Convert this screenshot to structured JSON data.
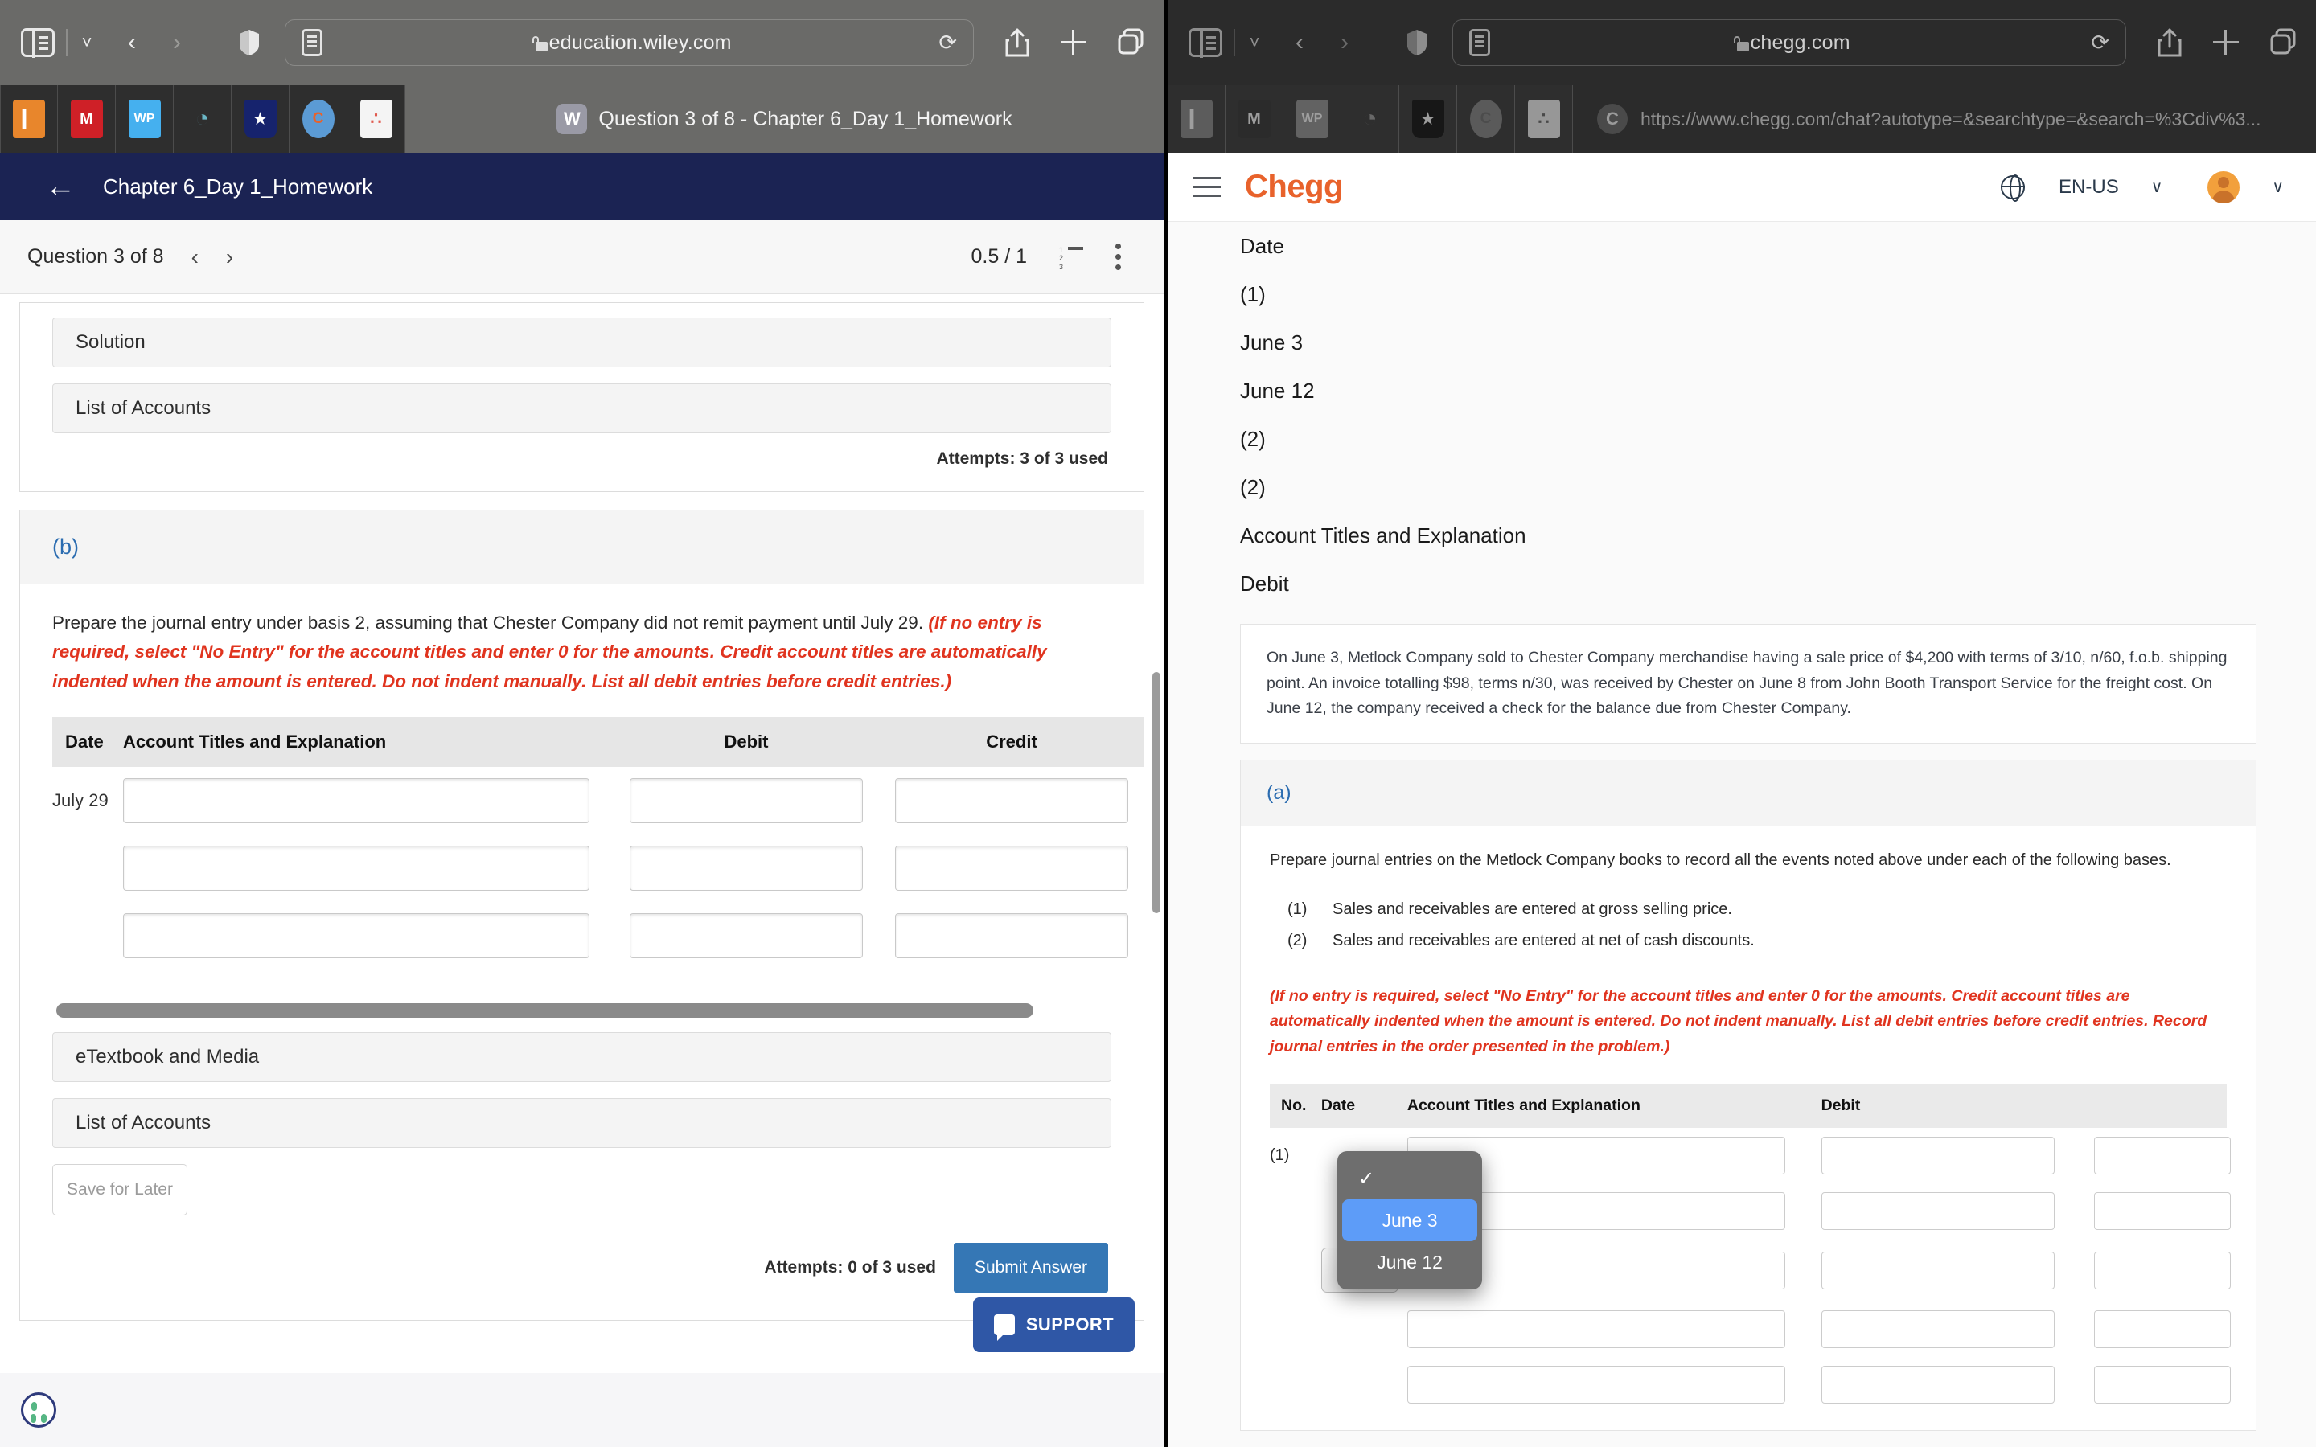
{
  "left_browser": {
    "url": "education.wiley.com",
    "url_lock": "lock-icon",
    "tab_favicon_letter": "W",
    "tab_title": "Question 3 of 8 - Chapter 6_Day 1_Homework",
    "favorites": [
      {
        "name": "bookmark-orange",
        "glyph": "▎"
      },
      {
        "name": "bookmark-m",
        "glyph": "M"
      },
      {
        "name": "bookmark-wp",
        "glyph": "WP"
      },
      {
        "name": "bookmark-vialto",
        "glyph": "◔"
      },
      {
        "name": "bookmark-star-shield",
        "glyph": "★"
      },
      {
        "name": "bookmark-chegg",
        "glyph": "C"
      },
      {
        "name": "bookmark-canvas",
        "glyph": "∴"
      }
    ]
  },
  "right_browser": {
    "url": "chegg.com",
    "tab_favicon_letter": "C",
    "full_url": "https://www.chegg.com/chat?autotype=&searchtype=&search=%3Cdiv%3...",
    "favorites": [
      {
        "name": "bookmark-orange",
        "glyph": "▎"
      },
      {
        "name": "bookmark-m",
        "glyph": "M"
      },
      {
        "name": "bookmark-wp",
        "glyph": "WP"
      },
      {
        "name": "bookmark-vialto",
        "glyph": "◔"
      },
      {
        "name": "bookmark-star-shield",
        "glyph": "★"
      },
      {
        "name": "bookmark-chegg",
        "glyph": "C"
      },
      {
        "name": "bookmark-canvas",
        "glyph": "∴"
      }
    ]
  },
  "wiley": {
    "header_title": "Chapter 6_Day 1_Homework",
    "back_arrow": "back-arrow-icon",
    "question_label": "Question 3 of 8",
    "prev_chevron": "‹",
    "next_chevron": "›",
    "score": "0.5 / 1",
    "part_a": {
      "solution_label": "Solution",
      "list_of_accounts_label": "List of Accounts",
      "attempts": "Attempts: 3 of 3 used"
    },
    "part_b": {
      "letter": "(b)",
      "prompt_plain": "Prepare the journal entry under basis 2, assuming that Chester Company did not remit payment until July 29. ",
      "prompt_red": "(If no entry is required, select \"No Entry\" for the account titles and enter 0 for the amounts. Credit account titles are automatically indented when the amount is entered. Do not indent manually. List all debit entries before credit entries.)",
      "table_headers": [
        "Date",
        "Account Titles and Explanation",
        "Debit",
        "Credit"
      ],
      "rows": [
        {
          "date": "July 29",
          "account": "",
          "debit": "",
          "credit": ""
        },
        {
          "date": "",
          "account": "",
          "debit": "",
          "credit": ""
        },
        {
          "date": "",
          "account": "",
          "debit": "",
          "credit": ""
        }
      ],
      "etextbook_label": "eTextbook and Media",
      "list_of_accounts_label": "List of Accounts",
      "save_for_later": "Save for Later",
      "attempts": "Attempts: 0 of 3 used",
      "submit_label": "Submit Answer"
    },
    "support_label": "SUPPORT"
  },
  "chegg": {
    "logo": "Chegg",
    "language": "EN-US",
    "plain_lines": [
      "Date",
      "(1)",
      "June 3",
      "June 12",
      "(2)",
      "(2)",
      "Account Titles and Explanation",
      "Debit"
    ],
    "problem_text": "On June 3, Metlock Company sold to Chester Company merchandise having a sale price of $4,200 with terms of 3/10, n/60, f.o.b. shipping point. An invoice totalling $98, terms n/30, was received by Chester on June 8 from John Booth Transport Service for the freight cost. On June 12, the company received a check for the balance due from Chester Company.",
    "part_a": {
      "letter": "(a)",
      "intro": "Prepare journal entries on the Metlock Company books to record all the events noted above under each of the following bases.",
      "bases": [
        {
          "n": "(1)",
          "text": "Sales and receivables are entered at gross selling price."
        },
        {
          "n": "(2)",
          "text": "Sales and receivables are entered at net of cash discounts."
        }
      ],
      "red_note": "(If no entry is required, select \"No Entry\" for the account titles and enter 0 for the amounts. Credit account titles are automatically indented when the amount is entered. Do not indent manually. List all debit entries before credit entries. Record journal entries in the order presented in the problem.)",
      "table_headers": [
        "No.",
        "Date",
        "Account Titles and Explanation",
        "Debit",
        ""
      ],
      "rows": [
        {
          "no": "(1)",
          "date": "",
          "account": "",
          "debit": "",
          "credit": ""
        },
        {
          "no": "",
          "date": "",
          "account": "",
          "debit": "",
          "credit": ""
        },
        {
          "no": "",
          "date": "stepper",
          "account": "",
          "debit": "",
          "credit": ""
        },
        {
          "no": "",
          "date": "",
          "account": "",
          "debit": "",
          "credit": ""
        },
        {
          "no": "",
          "date": "",
          "account": "",
          "debit": "",
          "credit": ""
        }
      ]
    },
    "date_dropdown": {
      "options": [
        {
          "label": "✓",
          "state": "checked-blank"
        },
        {
          "label": "June 3",
          "state": "selected"
        },
        {
          "label": "June 12",
          "state": "normal"
        }
      ]
    }
  },
  "colors": {
    "wiley_navy": "#1b2353",
    "wiley_blue": "#3577b5",
    "chegg_orange": "#e8622b",
    "red_note": "#e0341f",
    "support_blue": "#2f57a6",
    "dropdown_select": "#5d9cf8"
  }
}
